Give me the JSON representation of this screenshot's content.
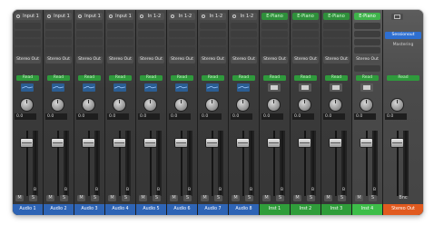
{
  "strips": [
    {
      "kind": "audio",
      "input": "Input 1",
      "output": "Stereo Out",
      "automation": "Read",
      "pan": "0.0",
      "group": "B",
      "mute": "M",
      "solo": "S",
      "name": "Audio 1"
    },
    {
      "kind": "audio",
      "input": "Input 1",
      "output": "Stereo Out",
      "automation": "Read",
      "pan": "0.0",
      "group": "B",
      "mute": "M",
      "solo": "S",
      "name": "Audio 2"
    },
    {
      "kind": "audio",
      "input": "Input 1",
      "output": "Stereo Out",
      "automation": "Read",
      "pan": "0.0",
      "group": "B",
      "mute": "M",
      "solo": "S",
      "name": "Audio 3"
    },
    {
      "kind": "audio",
      "input": "Input 1",
      "output": "Stereo Out",
      "automation": "Read",
      "pan": "0.0",
      "group": "B",
      "mute": "M",
      "solo": "S",
      "name": "Audio 4"
    },
    {
      "kind": "audio",
      "input": "In 1-2",
      "output": "Stereo Out",
      "automation": "Read",
      "pan": "0.0",
      "group": "B",
      "mute": "M",
      "solo": "S",
      "name": "Audio 5"
    },
    {
      "kind": "audio",
      "input": "In 1-2",
      "output": "Stereo Out",
      "automation": "Read",
      "pan": "0.0",
      "group": "B",
      "mute": "M",
      "solo": "S",
      "name": "Audio 6"
    },
    {
      "kind": "audio",
      "input": "In 1-2",
      "output": "Stereo Out",
      "automation": "Read",
      "pan": "0.0",
      "group": "B",
      "mute": "M",
      "solo": "S",
      "name": "Audio 7"
    },
    {
      "kind": "audio",
      "input": "In 1-2",
      "output": "Stereo Out",
      "automation": "Read",
      "pan": "0.0",
      "group": "B",
      "mute": "M",
      "solo": "S",
      "name": "Audio 8"
    },
    {
      "kind": "inst",
      "input": "E-Piano",
      "output": "Stereo Out",
      "automation": "Read",
      "pan": "0.0",
      "group": "B",
      "mute": "M",
      "solo": "S",
      "name": "Inst 1"
    },
    {
      "kind": "inst",
      "input": "E-Piano",
      "output": "Stereo Out",
      "automation": "Read",
      "pan": "0.0",
      "group": "B",
      "mute": "M",
      "solo": "S",
      "name": "Inst 2"
    },
    {
      "kind": "inst",
      "input": "E-Piano",
      "output": "Stereo Out",
      "automation": "Read",
      "pan": "0.0",
      "group": "B",
      "mute": "M",
      "solo": "S",
      "name": "Inst 3"
    },
    {
      "kind": "inst",
      "input": "E-Piano",
      "output": "Stereo Out",
      "automation": "Read",
      "pan": "0.0",
      "group": "B",
      "mute": "M",
      "solo": "S",
      "name": "Inst 4",
      "selected": true
    }
  ],
  "master": {
    "session_button": "Sessionout",
    "mastering_label": "Mastering",
    "automation": "Read",
    "pan": "0.0",
    "bounce": "Bnc",
    "name": "Stereo Out"
  },
  "colors": {
    "audio": "#2e64b5",
    "instrument": "#2f9d3a",
    "output": "#e15a1f",
    "read": "#2f9a3c"
  }
}
